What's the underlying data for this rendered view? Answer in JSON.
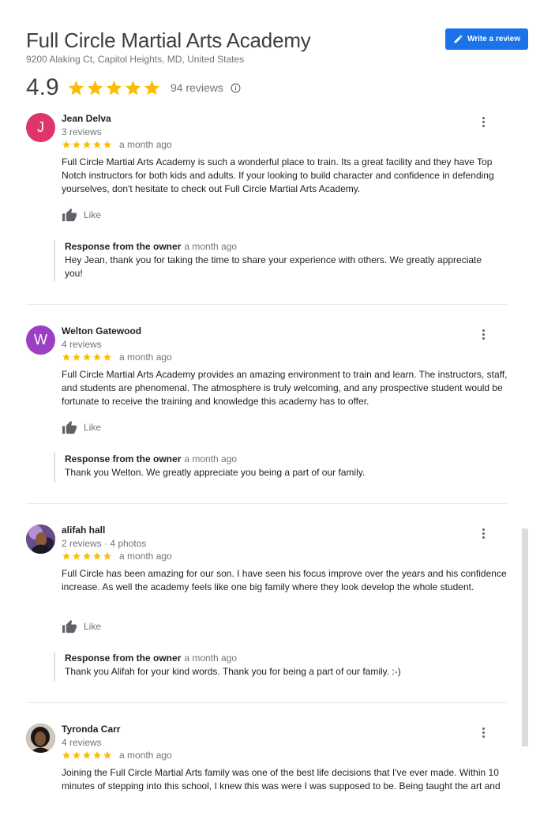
{
  "business": {
    "name": "Full Circle Martial Arts Academy",
    "address": "9200 Alaking Ct, Capitol Heights, MD, United States",
    "rating": "4.9",
    "review_count": "94 reviews",
    "write_review_label": "Write a review"
  },
  "colors": {
    "star": "#fbbc04",
    "accent": "#1a73e8"
  },
  "reviews": [
    {
      "author": "Jean Delva",
      "initial": "J",
      "avatar_color": "#e0356b",
      "meta": "3 reviews",
      "stars": 5,
      "time": "a month ago",
      "text": "Full Circle Martial Arts Academy is such a wonderful place to train. Its a great facility and they have Top Notch instructors for both kids and adults. If your looking to build character and confidence in defending yourselves, don't hesitate to check out Full Circle Martial Arts Academy.",
      "like_label": "Like",
      "response_label": "Response from the owner",
      "response_time": "a month ago",
      "response_text": "Hey Jean, thank you for taking the time to share your experience with others. We greatly appreciate you!"
    },
    {
      "author": "Welton Gatewood",
      "initial": "W",
      "avatar_color": "#9c3fc4",
      "meta": "4 reviews",
      "stars": 5,
      "time": "a month ago",
      "text": "Full Circle Martial Arts Academy provides an amazing environment to train and learn. The instructors, staff, and students are phenomenal. The atmosphere is truly welcoming, and any prospective student would be fortunate to receive the training and knowledge this academy has to offer.",
      "like_label": "Like",
      "response_label": "Response from the owner",
      "response_time": "a month ago",
      "response_text": "Thank you Welton. We greatly appreciate you being a part of our family."
    },
    {
      "author": "alifah hall",
      "initial": "",
      "avatar_color": "#3a2a4a",
      "meta": "2 reviews · 4 photos",
      "stars": 5,
      "time": "a month ago",
      "text": "Full Circle has been amazing for our son. I have seen his focus improve over the years and his confidence increase. As well the academy feels like one big family where they look develop the whole student.",
      "like_label": "Like",
      "response_label": "Response from the owner",
      "response_time": "a month ago",
      "response_text": "Thank you Alifah for your kind words. Thank you for being a part of our family. :-)"
    },
    {
      "author": "Tyronda Carr",
      "initial": "",
      "avatar_color": "#2b2420",
      "meta": "4 reviews",
      "stars": 5,
      "time": "a month ago",
      "text": "Joining the Full Circle Martial Arts family was one of the best life decisions that I've ever made. Within 10 minutes of stepping into this school, I knew this was were I was supposed to be. Being taught the art and"
    }
  ]
}
